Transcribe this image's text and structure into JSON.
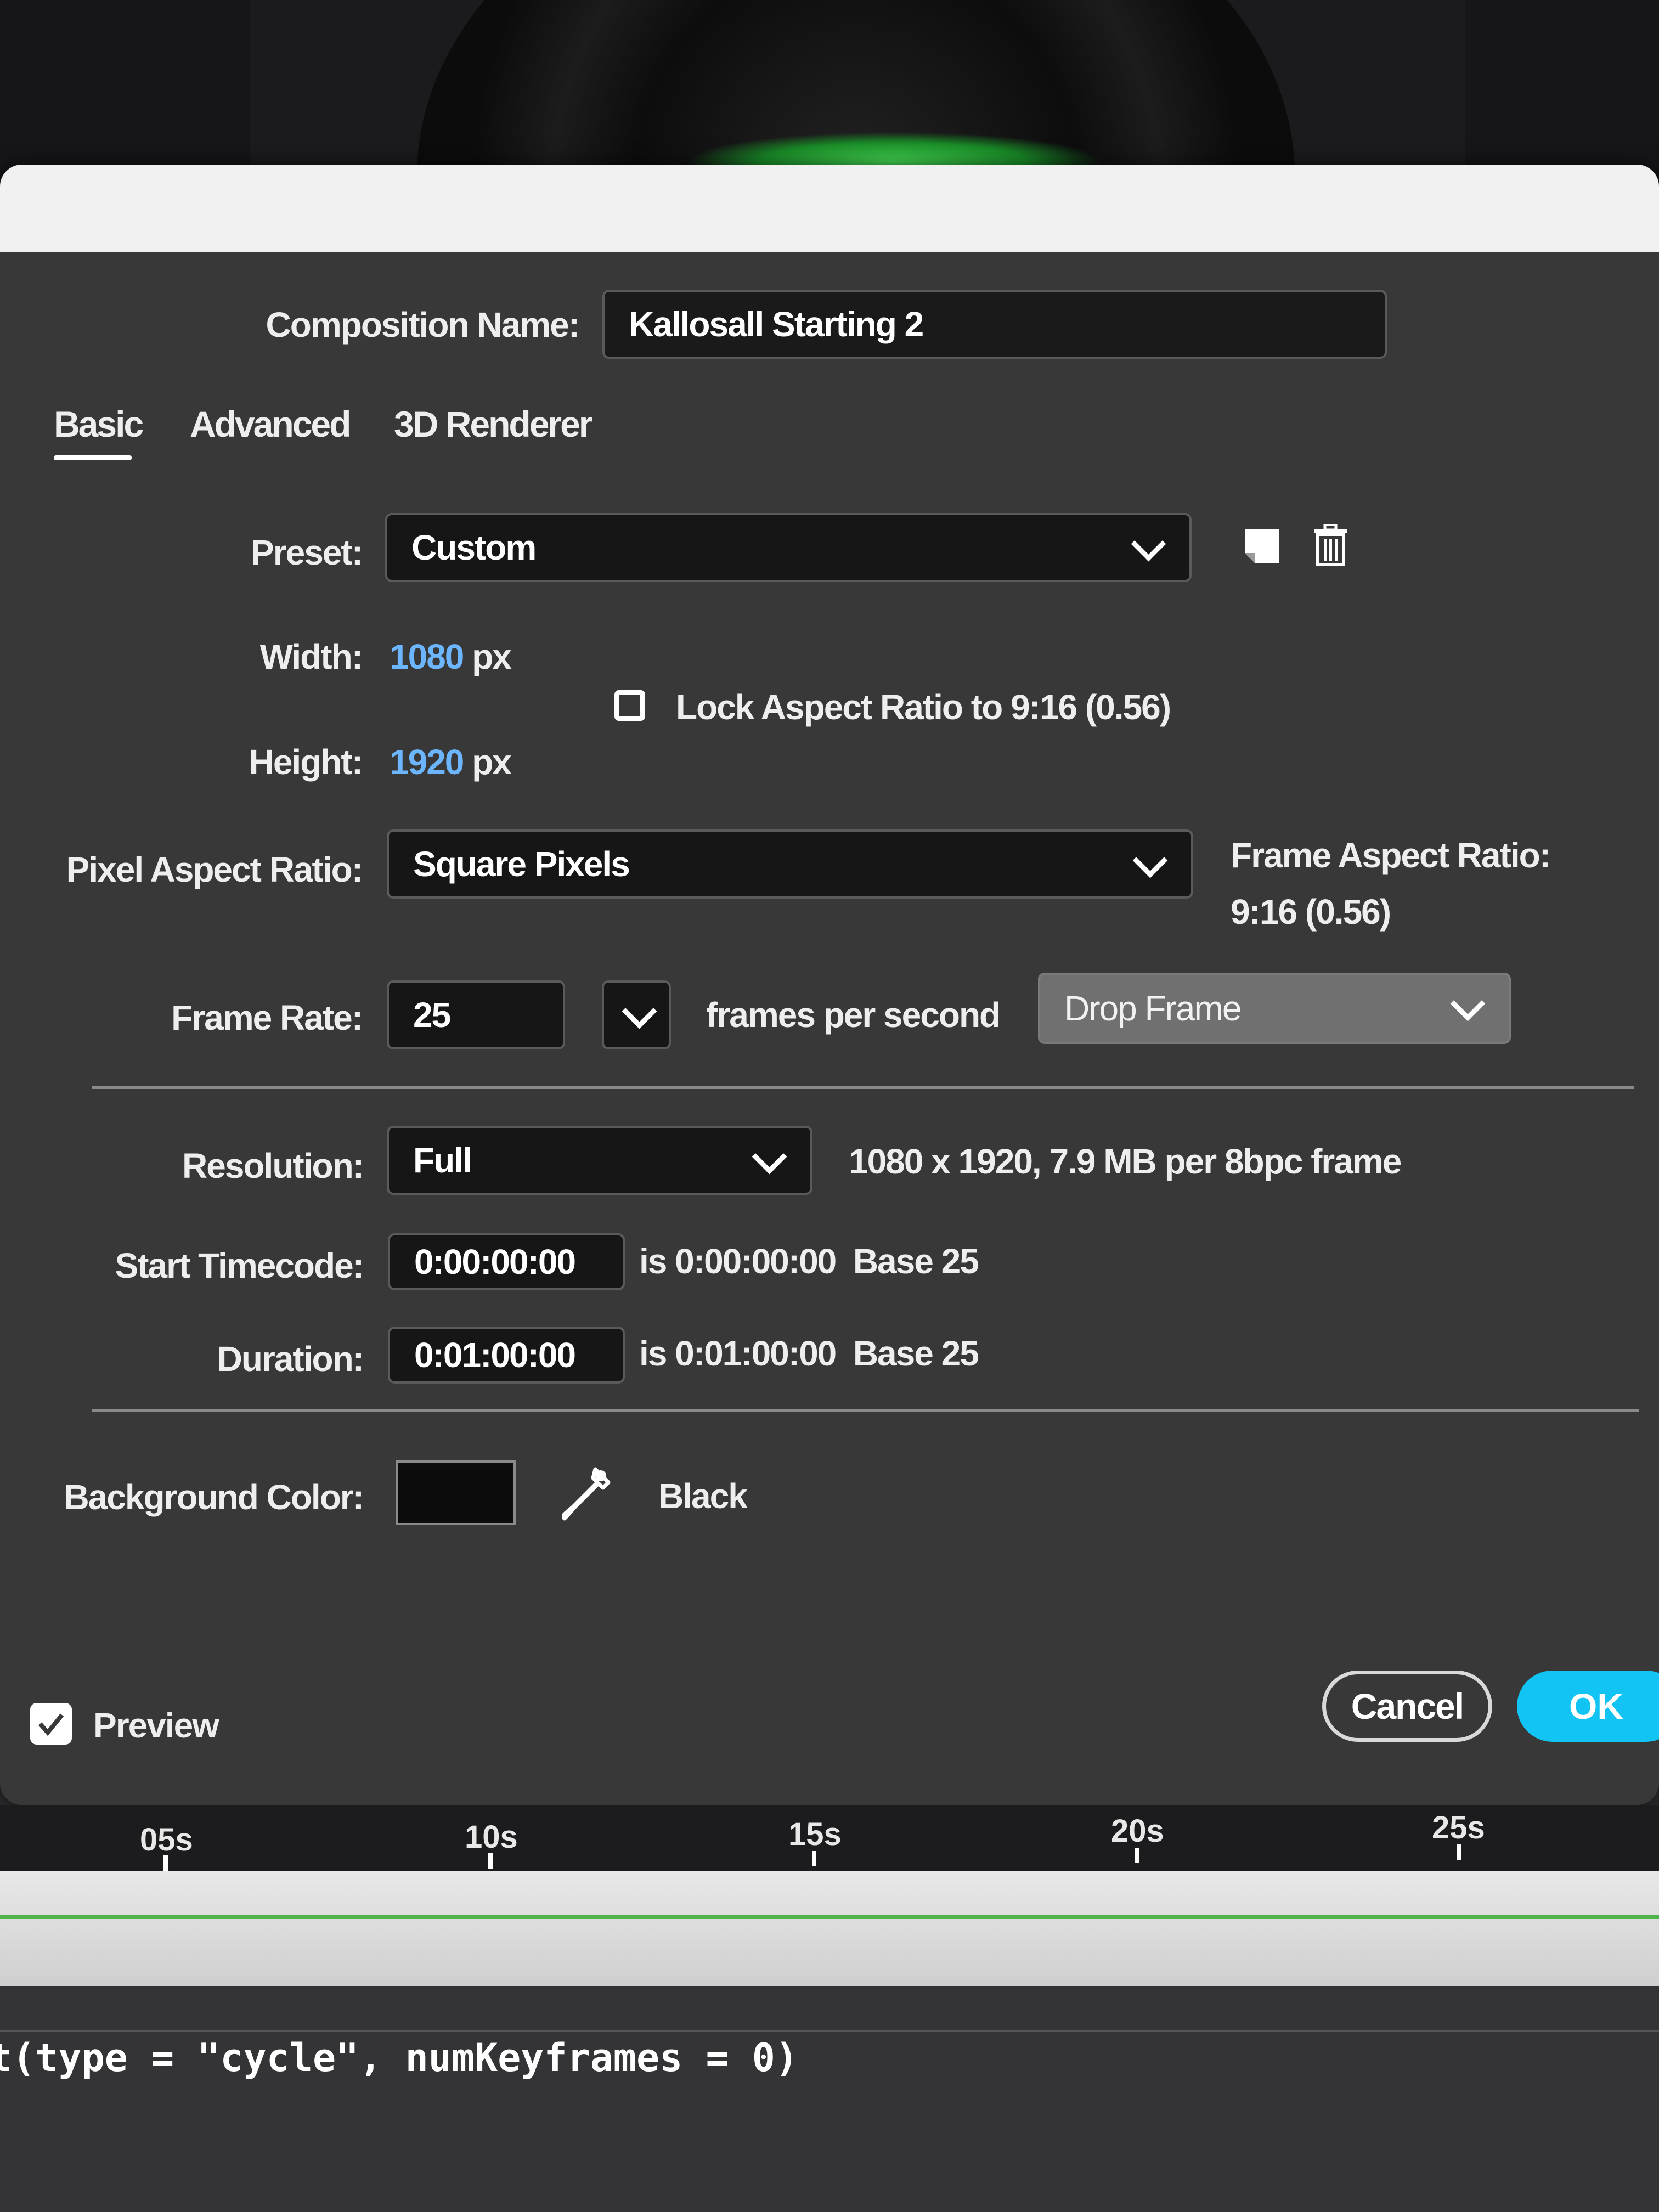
{
  "composition": {
    "name_label": "Composition Name:",
    "name_value": "Kallosall Starting 2"
  },
  "tabs": [
    {
      "label": "Basic",
      "active": true
    },
    {
      "label": "Advanced",
      "active": false
    },
    {
      "label": "3D Renderer",
      "active": false
    }
  ],
  "preset": {
    "label": "Preset:",
    "value": "Custom",
    "save_icon": "save-preset-icon",
    "delete_icon": "trash-icon"
  },
  "width": {
    "label": "Width:",
    "value": "1080",
    "unit": "px"
  },
  "height": {
    "label": "Height:",
    "value": "1920",
    "unit": "px"
  },
  "lock_aspect": {
    "label": "Lock Aspect Ratio to 9:16 (0.56)",
    "checked": false
  },
  "pixel_aspect": {
    "label": "Pixel Aspect Ratio:",
    "value": "Square Pixels"
  },
  "frame_aspect": {
    "label": "Frame Aspect Ratio:",
    "value": "9:16 (0.56)"
  },
  "frame_rate": {
    "label": "Frame Rate:",
    "value": "25",
    "unit": "frames per second",
    "drop_frame": "Drop Frame"
  },
  "resolution": {
    "label": "Resolution:",
    "value": "Full",
    "info": "1080 x 1920, 7.9 MB per 8bpc frame"
  },
  "start_timecode": {
    "label": "Start Timecode:",
    "value": "0:00:00:00",
    "info_is": "is 0:00:00:00",
    "info_base": "Base 25"
  },
  "duration": {
    "label": "Duration:",
    "value": "0:01:00:00",
    "info_is": "is 0:01:00:00",
    "info_base": "Base 25"
  },
  "background": {
    "label": "Background Color:",
    "color": "#0c0c0c",
    "name": "Black",
    "eyedropper_icon": "eyedropper-icon"
  },
  "preview": {
    "label": "Preview",
    "checked": true
  },
  "buttons": {
    "cancel": "Cancel",
    "ok": "OK"
  },
  "colors": {
    "accent": "#12c4f3",
    "link_blue": "#6cb6ff",
    "dialog_bg": "#393839"
  },
  "timeline": {
    "ticks": [
      "05s",
      "10s",
      "15s",
      "20s",
      "25s"
    ]
  },
  "code": {
    "line": "t(type = \"cycle\", numKeyframes = 0)"
  }
}
